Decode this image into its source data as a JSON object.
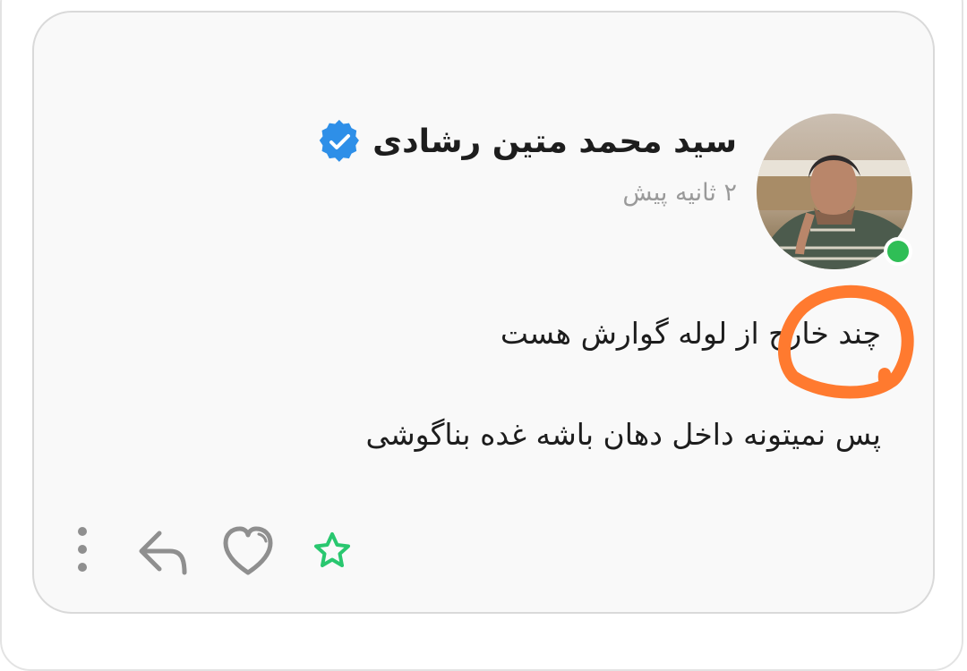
{
  "post": {
    "author_name": "سید محمد متین رشادی",
    "time_ago": "۲ ثانیه پیش",
    "lines": [
      "چند خارج از لوله گوارش هست",
      "پس نمیتونه داخل دهان باشه غده بناگوشی"
    ]
  },
  "colors": {
    "card_background": "#f9f9f9",
    "online_status": "#2fbe56",
    "verified_badge": "#2e8fe8",
    "annotation_stroke": "#ff7a2f",
    "favorite_star": "#29c76f"
  },
  "icons": {
    "verified": "verified-badge-icon",
    "more": "more-vertical-icon",
    "reply": "reply-icon",
    "like": "heart-icon",
    "favorite": "star-icon"
  }
}
